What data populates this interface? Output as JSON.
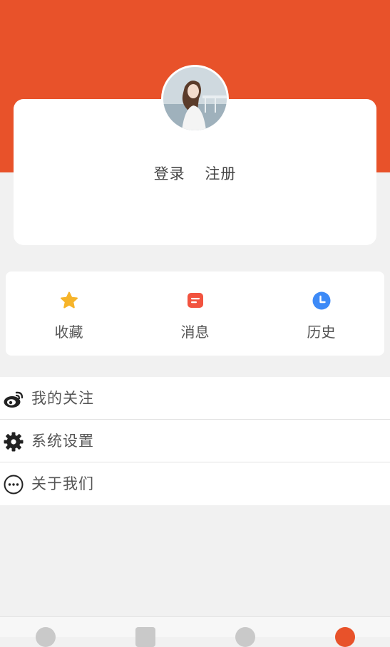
{
  "header": {
    "brand_color": "#e8522a"
  },
  "profile": {
    "avatar_icon": "avatar-photo",
    "login_label": "登录",
    "register_label": "注册"
  },
  "quick_actions": [
    {
      "label": "收藏",
      "icon": "star-icon",
      "color": "#f6b42a"
    },
    {
      "label": "消息",
      "icon": "message-icon",
      "color": "#f2533f"
    },
    {
      "label": "历史",
      "icon": "clock-icon",
      "color": "#3d8af7"
    }
  ],
  "menu": [
    {
      "label": "我的关注",
      "icon": "weibo-icon"
    },
    {
      "label": "系统设置",
      "icon": "gear-icon"
    },
    {
      "label": "关于我们",
      "icon": "more-dots-icon"
    }
  ],
  "tabbar": {
    "tabs": [
      {
        "icon": "home-icon"
      },
      {
        "icon": "add-icon"
      },
      {
        "icon": "send-icon"
      },
      {
        "icon": "user-icon",
        "active": true
      }
    ]
  }
}
